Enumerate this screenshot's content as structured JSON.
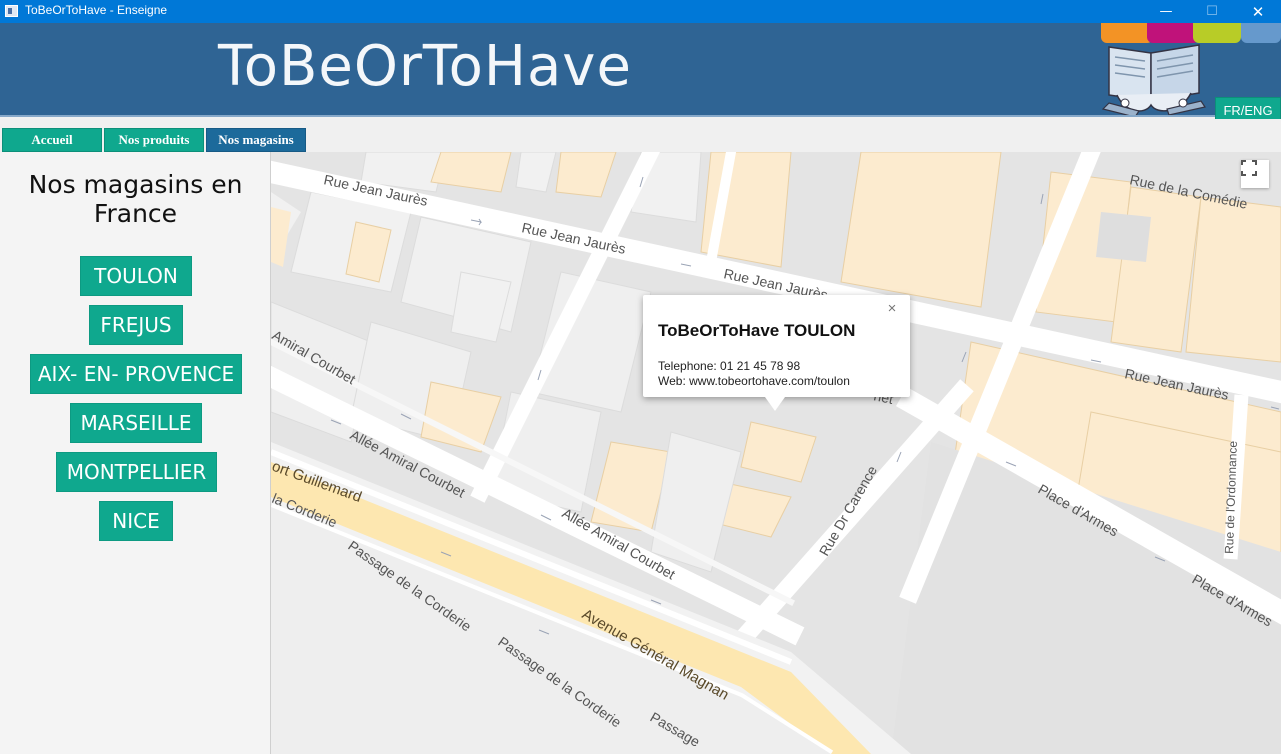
{
  "window": {
    "title": "ToBeOrToHave - Enseigne",
    "minimize_glyph": "—",
    "maximize_glyph": "☐",
    "close_glyph": "✕"
  },
  "banner": {
    "title": "ToBeOrToHave",
    "lang_button": "FR/ENG",
    "strip_colors": [
      "#f39325",
      "#c0127a",
      "#b8cc27",
      "#6699cc"
    ]
  },
  "tabs": [
    {
      "label": "Accueil",
      "active": false
    },
    {
      "label": "Nos produits",
      "active": false
    },
    {
      "label": "Nos magasins",
      "active": true
    }
  ],
  "sidebar": {
    "title": "Nos magasins en France",
    "cities": [
      "TOULON",
      "FREJUS",
      "AIX- EN- PROVENCE",
      "MARSEILLE",
      "MONTPELLIER",
      "NICE"
    ]
  },
  "map": {
    "streets": [
      "Rue Jean Jaurès",
      "Rue Jean Jaurès",
      "Rue Jean Jaurès",
      "Rue Jean Jaurès",
      "Rue de la Comédie",
      "Amiral Courbet",
      "Allée Amiral Courbet",
      "Allée Amiral Courbet",
      "Rue Dr Carence",
      "Place d'Armes",
      "Place d'Armes",
      "Rue de l'Ordonnance",
      "ort Guillemard",
      "la Corderie",
      "Passage de la Corderie",
      "Passage de la Corderie",
      "Passage",
      "Avenue Général Magnan",
      "net"
    ],
    "info_window": {
      "title": "ToBeOrToHave TOULON",
      "telephone": "Telephone: 01 21 45 78 98",
      "web": "Web: www.tobeortohave.com/toulon",
      "close_glyph": "×"
    },
    "fullscreen_icon": "fullscreen-icon",
    "colors": {
      "road": "#ffffff",
      "block": "#e8e8e8",
      "building": "#f1f1f1",
      "highlight_building": "#fcebcf",
      "avenue": "#fde7b0"
    }
  }
}
